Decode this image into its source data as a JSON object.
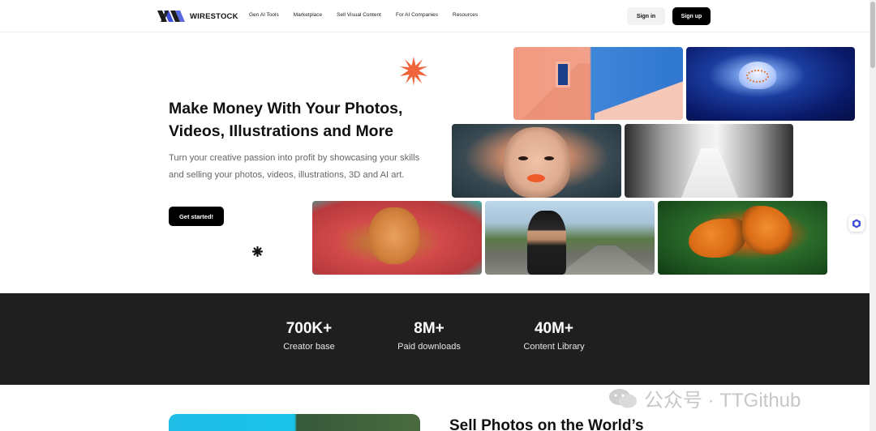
{
  "brand": {
    "name": "WIRESTOCK"
  },
  "nav": {
    "links": [
      "Gen AI Tools",
      "Marketplace",
      "Sell Visual Content",
      "For AI Companies",
      "Resources"
    ],
    "signin_label": "Sign in",
    "signup_label": "Sign up"
  },
  "hero": {
    "title_line1": "Make Money With Your Photos,",
    "title_line2": "Videos, Illustrations and More",
    "subtitle": "Turn your creative passion into profit by showcasing your skills and selling your photos, videos, illustrations, 3D and AI art.",
    "cta_label": "Get started!"
  },
  "stats": [
    {
      "value": "700K+",
      "label": "Creator base"
    },
    {
      "value": "8M+",
      "label": "Paid downloads"
    },
    {
      "value": "40M+",
      "label": "Content Library"
    }
  ],
  "teaser": {
    "title": "Sell Photos on the World’s"
  },
  "watermark": {
    "text": "公众号 · TTGithub"
  },
  "colors": {
    "accent_orange": "#f0643c",
    "stats_bg": "#1f1f1f",
    "primary_button": "#000000"
  }
}
